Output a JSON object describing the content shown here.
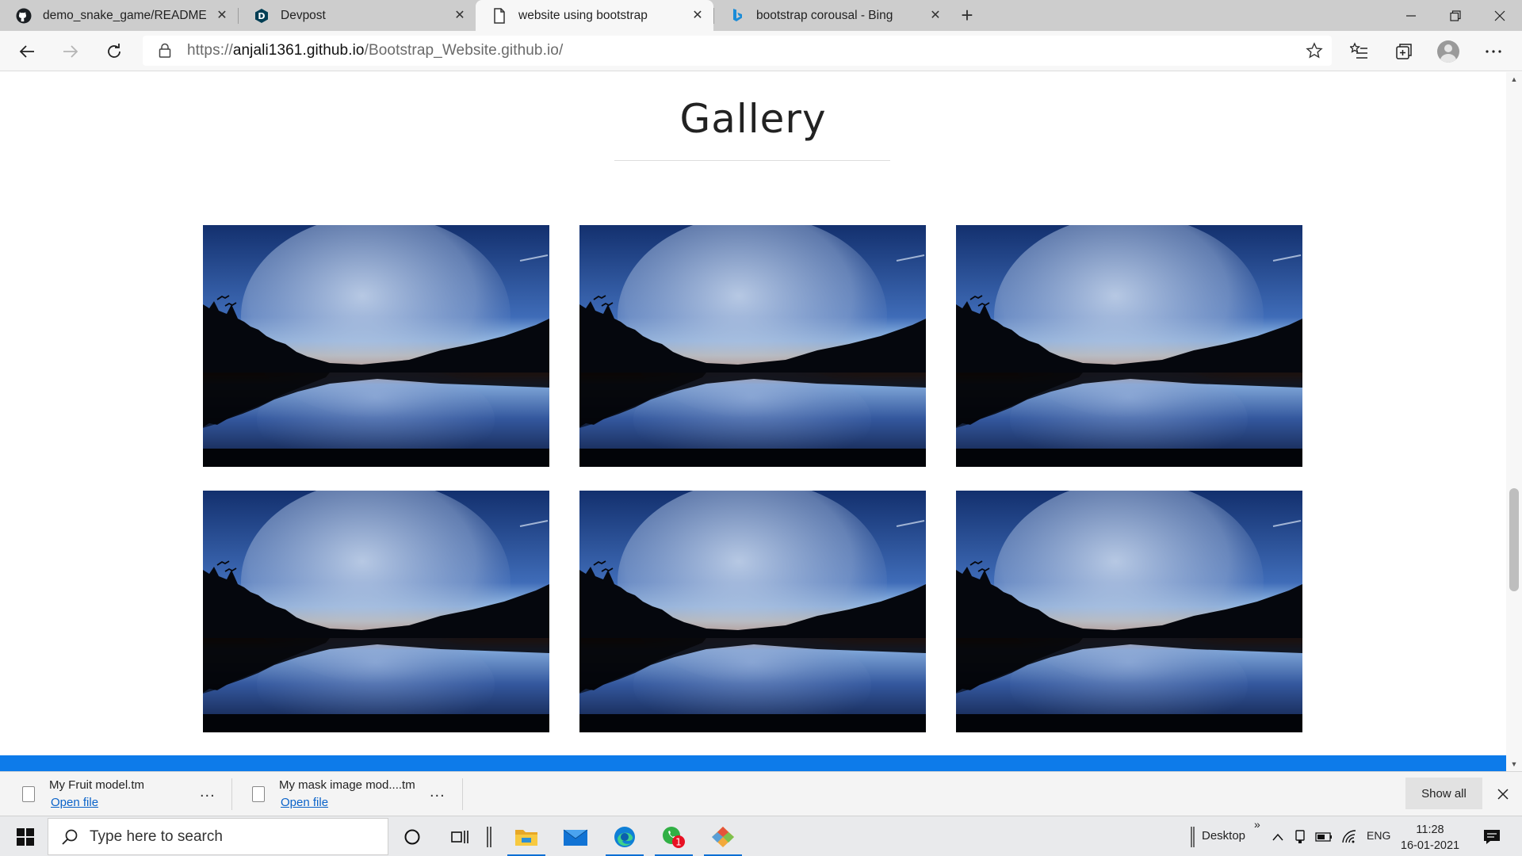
{
  "browser": {
    "tabs": [
      {
        "title": "demo_snake_game/README.md",
        "icon": "github-icon",
        "active": false
      },
      {
        "title": "Devpost",
        "icon": "devpost-icon",
        "active": false
      },
      {
        "title": "website using bootstrap",
        "icon": "page-icon",
        "active": true
      },
      {
        "title": "bootstrap corousal - Bing",
        "icon": "bing-icon",
        "active": false
      }
    ],
    "new_tab_label": "+",
    "url_prefix": "https://",
    "url_host": "anjali1361.github.io",
    "url_path": "/Bootstrap_Website.github.io/"
  },
  "page": {
    "heading": "Gallery",
    "photos": [
      {
        "alt": "moon-over-lake"
      },
      {
        "alt": "moon-over-lake"
      },
      {
        "alt": "moon-over-lake"
      },
      {
        "alt": "moon-over-lake"
      },
      {
        "alt": "moon-over-lake"
      },
      {
        "alt": "moon-over-lake"
      }
    ],
    "band_color": "#0d7bea"
  },
  "downloads": {
    "items": [
      {
        "name": "My Fruit model.tm",
        "action": "Open file"
      },
      {
        "name": "My mask image mod....tm",
        "action": "Open file"
      }
    ],
    "more_label": "...",
    "show_all_label": "Show all"
  },
  "taskbar": {
    "search_placeholder": "Type here to search",
    "desktop_label": "Desktop",
    "language": "ENG",
    "time": "11:28",
    "date": "16-01-2021",
    "whatsapp_badge": "1",
    "overflow_label": "»"
  }
}
